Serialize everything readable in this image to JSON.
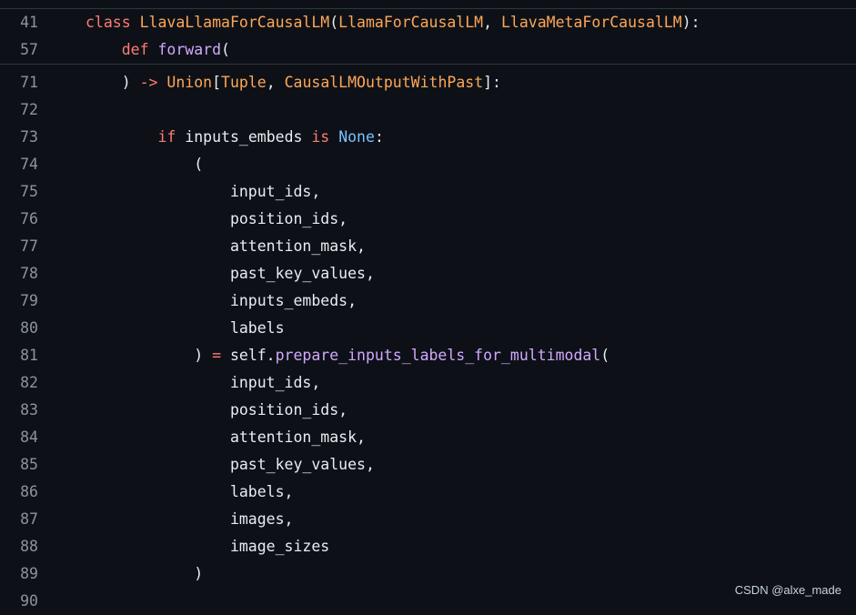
{
  "lines": [
    {
      "num": "41",
      "tokens": [
        [
          "kw",
          "class "
        ],
        [
          "cls",
          "LlavaLlamaForCausalLM"
        ],
        [
          "pl",
          "("
        ],
        [
          "cls",
          "LlamaForCausalLM"
        ],
        [
          "pl",
          ", "
        ],
        [
          "cls",
          "LlavaMetaForCausalLM"
        ],
        [
          "pl",
          "):"
        ]
      ]
    },
    {
      "num": "57",
      "tokens": [
        [
          "pl",
          "    "
        ],
        [
          "kw",
          "def "
        ],
        [
          "fn",
          "forward"
        ],
        [
          "pl",
          "("
        ]
      ]
    },
    {
      "num": "71",
      "tokens": [
        [
          "pl",
          "    ) "
        ],
        [
          "kw",
          "->"
        ],
        [
          "pl",
          " "
        ],
        [
          "cls",
          "Union"
        ],
        [
          "pl",
          "["
        ],
        [
          "cls",
          "Tuple"
        ],
        [
          "pl",
          ", "
        ],
        [
          "cls",
          "CausalLMOutputWithPast"
        ],
        [
          "pl",
          "]:"
        ]
      ]
    },
    {
      "num": "72",
      "tokens": []
    },
    {
      "num": "73",
      "tokens": [
        [
          "pl",
          "        "
        ],
        [
          "kw",
          "if"
        ],
        [
          "pl",
          " inputs_embeds "
        ],
        [
          "kw",
          "is"
        ],
        [
          "pl",
          " "
        ],
        [
          "con",
          "None"
        ],
        [
          "pl",
          ":"
        ]
      ]
    },
    {
      "num": "74",
      "tokens": [
        [
          "pl",
          "            ("
        ]
      ]
    },
    {
      "num": "75",
      "tokens": [
        [
          "pl",
          "                input_ids,"
        ]
      ]
    },
    {
      "num": "76",
      "tokens": [
        [
          "pl",
          "                position_ids,"
        ]
      ]
    },
    {
      "num": "77",
      "tokens": [
        [
          "pl",
          "                attention_mask,"
        ]
      ]
    },
    {
      "num": "78",
      "tokens": [
        [
          "pl",
          "                past_key_values,"
        ]
      ]
    },
    {
      "num": "79",
      "tokens": [
        [
          "pl",
          "                inputs_embeds,"
        ]
      ]
    },
    {
      "num": "80",
      "tokens": [
        [
          "pl",
          "                labels"
        ]
      ]
    },
    {
      "num": "81",
      "tokens": [
        [
          "pl",
          "            ) "
        ],
        [
          "kw",
          "="
        ],
        [
          "pl",
          " self."
        ],
        [
          "fn",
          "prepare_inputs_labels_for_multimodal"
        ],
        [
          "pl",
          "("
        ]
      ]
    },
    {
      "num": "82",
      "tokens": [
        [
          "pl",
          "                input_ids,"
        ]
      ]
    },
    {
      "num": "83",
      "tokens": [
        [
          "pl",
          "                position_ids,"
        ]
      ]
    },
    {
      "num": "84",
      "tokens": [
        [
          "pl",
          "                attention_mask,"
        ]
      ]
    },
    {
      "num": "85",
      "tokens": [
        [
          "pl",
          "                past_key_values,"
        ]
      ]
    },
    {
      "num": "86",
      "tokens": [
        [
          "pl",
          "                labels,"
        ]
      ]
    },
    {
      "num": "87",
      "tokens": [
        [
          "pl",
          "                images,"
        ]
      ]
    },
    {
      "num": "88",
      "tokens": [
        [
          "pl",
          "                image_sizes"
        ]
      ]
    },
    {
      "num": "89",
      "tokens": [
        [
          "pl",
          "            )"
        ]
      ]
    },
    {
      "num": "90",
      "tokens": []
    }
  ],
  "watermark": "CSDN @alxe_made"
}
